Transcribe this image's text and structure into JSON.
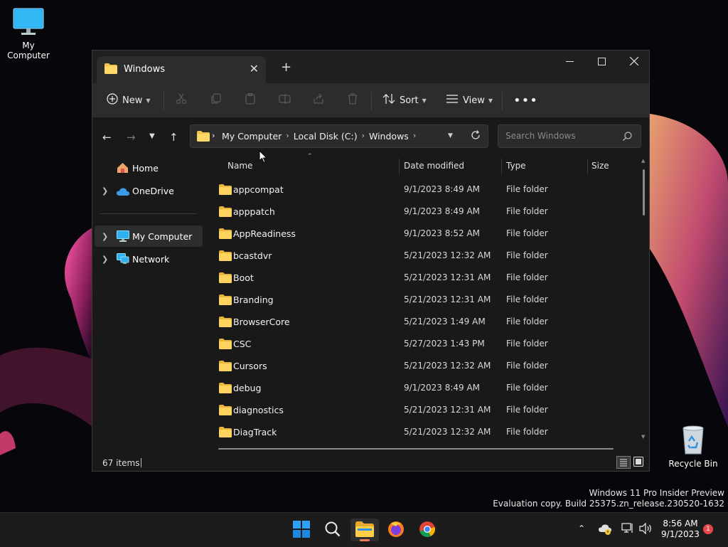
{
  "desktop": {
    "icons": [
      {
        "label": "My Computer"
      },
      {
        "label": "Recycle Bin"
      }
    ],
    "watermark": {
      "line1": "Windows 11 Pro Insider Preview",
      "line2": "Evaluation copy. Build 25375.zn_release.230520-1632"
    }
  },
  "window": {
    "tab_title": "Windows",
    "toolbar": {
      "new_label": "New",
      "sort_label": "Sort",
      "view_label": "View"
    },
    "address": {
      "crumbs": [
        "My Computer",
        "Local Disk (C:)",
        "Windows"
      ]
    },
    "search": {
      "placeholder": "Search Windows"
    },
    "sidebar": {
      "items": [
        {
          "label": "Home"
        },
        {
          "label": "OneDrive"
        },
        {
          "label": "My Computer"
        },
        {
          "label": "Network"
        }
      ]
    },
    "columns": [
      "Name",
      "Date modified",
      "Type",
      "Size"
    ],
    "rows": [
      {
        "name": "appcompat",
        "date": "9/1/2023 8:49 AM",
        "type": "File folder"
      },
      {
        "name": "apppatch",
        "date": "9/1/2023 8:49 AM",
        "type": "File folder"
      },
      {
        "name": "AppReadiness",
        "date": "9/1/2023 8:52 AM",
        "type": "File folder"
      },
      {
        "name": "bcastdvr",
        "date": "5/21/2023 12:32 AM",
        "type": "File folder"
      },
      {
        "name": "Boot",
        "date": "5/21/2023 12:31 AM",
        "type": "File folder"
      },
      {
        "name": "Branding",
        "date": "5/21/2023 12:31 AM",
        "type": "File folder"
      },
      {
        "name": "BrowserCore",
        "date": "5/21/2023 1:49 AM",
        "type": "File folder"
      },
      {
        "name": "CSC",
        "date": "5/27/2023 1:43 PM",
        "type": "File folder"
      },
      {
        "name": "Cursors",
        "date": "5/21/2023 12:32 AM",
        "type": "File folder"
      },
      {
        "name": "debug",
        "date": "9/1/2023 8:49 AM",
        "type": "File folder"
      },
      {
        "name": "diagnostics",
        "date": "5/21/2023 12:31 AM",
        "type": "File folder"
      },
      {
        "name": "DiagTrack",
        "date": "5/21/2023 12:32 AM",
        "type": "File folder"
      }
    ],
    "status": {
      "items": "67 items"
    }
  },
  "taskbar": {
    "clock": {
      "time": "8:56 AM",
      "date": "9/1/2023"
    },
    "notification_count": "1"
  },
  "colors": {
    "folder_yellow": "#f3c44a",
    "window_bg": "#191919",
    "toolbar_bg": "#2c2c2c",
    "accent_blue": "#4cc2ff"
  }
}
